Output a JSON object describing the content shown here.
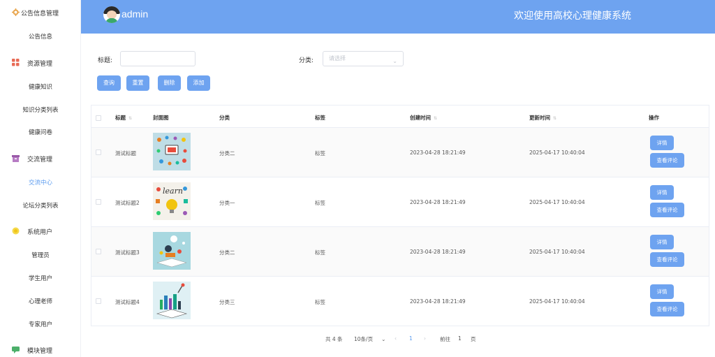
{
  "sidebar": {
    "groups": [
      {
        "label": "公告信息管理",
        "icon": "gear-icon",
        "items": [
          {
            "label": "公告信息"
          }
        ]
      },
      {
        "label": "资源管理",
        "icon": "grid-icon",
        "items": [
          {
            "label": "健康知识"
          },
          {
            "label": "知识分类列表"
          },
          {
            "label": "健康问卷"
          }
        ]
      },
      {
        "label": "交流管理",
        "icon": "box-icon",
        "items": [
          {
            "label": "交流中心",
            "active": true
          },
          {
            "label": "论坛分类列表"
          }
        ]
      },
      {
        "label": "系统用户",
        "icon": "sun-icon",
        "items": [
          {
            "label": "管理员"
          },
          {
            "label": "学生用户"
          },
          {
            "label": "心理老师"
          },
          {
            "label": "专家用户"
          }
        ]
      },
      {
        "label": "模块管理",
        "icon": "chat-icon",
        "items": []
      }
    ]
  },
  "header": {
    "username": "admin",
    "title": "欢迎使用高校心理健康系统"
  },
  "search": {
    "title_label": "标题:",
    "title_value": "",
    "category_label": "分类:",
    "category_placeholder": "请选择",
    "buttons": {
      "query": "查询",
      "reset": "重置",
      "delete": "删除",
      "add": "添加"
    }
  },
  "table": {
    "headers": {
      "title": "标题",
      "cover": "封面图",
      "category": "分类",
      "tag": "标签",
      "created": "创建时间",
      "updated": "更新时间",
      "actions": "操作"
    },
    "rows": [
      {
        "title": "测试标题",
        "category": "分类二",
        "tag": "标签",
        "created": "2023-04-28 18:21:49",
        "updated": "2025-04-17 10:40:04",
        "detail": "详情",
        "comments": "查看评论"
      },
      {
        "title": "测试标题2",
        "category": "分类一",
        "tag": "标签",
        "created": "2023-04-28 18:21:49",
        "updated": "2025-04-17 10:40:04",
        "detail": "详情",
        "comments": "查看评论"
      },
      {
        "title": "测试标题3",
        "category": "分类二",
        "tag": "标签",
        "created": "2023-04-28 18:21:49",
        "updated": "2025-04-17 10:40:04",
        "detail": "详情",
        "comments": "查看评论"
      },
      {
        "title": "测试标题4",
        "category": "分类三",
        "tag": "标签",
        "created": "2023-04-28 18:21:49",
        "updated": "2025-04-17 10:40:04",
        "detail": "详情",
        "comments": "查看评论"
      }
    ]
  },
  "pagination": {
    "total": "共 4 条",
    "page_size": "10条/页",
    "current_page": "1",
    "goto_prefix": "前往",
    "goto_value": "1",
    "goto_suffix": "页",
    "prev": "‹",
    "next": "›",
    "dropdown": "⌄"
  }
}
